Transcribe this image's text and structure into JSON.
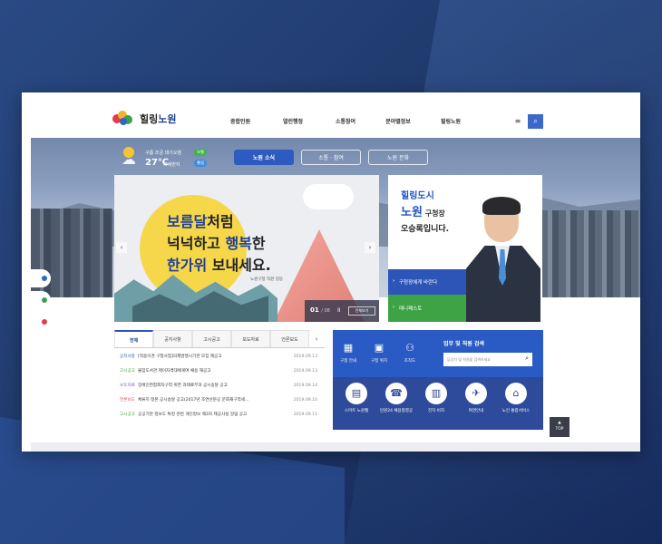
{
  "logo": {
    "name_prefix": "힐링",
    "name_main": "노원"
  },
  "gnb": [
    "종합민원",
    "열린행정",
    "소통참여",
    "분야별정보",
    "힐링노원"
  ],
  "header": {
    "menu_icon": "≡",
    "search_icon": "⌕"
  },
  "weather": {
    "line1": "구름 조금 대기오염",
    "temp": "27℃",
    "line2": "미세먼지",
    "badge_good1": "보통",
    "badge_good2": "좋음"
  },
  "visual_tabs": [
    {
      "label": "노원 소식",
      "active": true
    },
    {
      "label": "소통 · 참여",
      "active": false
    },
    {
      "label": "노원 문화",
      "active": false
    }
  ],
  "slide": {
    "line1_a": "보름달",
    "line1_b": "처럼",
    "line2_a": "넉넉하고 ",
    "line2_b": "행복",
    "line2_c": "한",
    "line3_a": "한가위",
    "line3_b": " 보내세요.",
    "sub": "노원구청 직원 일동",
    "counter_current": "01",
    "counter_total": "/ 08",
    "pause": "II",
    "view_all": "전체보기",
    "prev": "‹",
    "next": "›"
  },
  "mayor": {
    "line1": "힐링도시",
    "line2_name": "노원",
    "line2_title": " 구청장",
    "line3": "오승록입니다.",
    "btn1": "구청장에게 바란다",
    "btn2": "매니페스토",
    "chevron": "›"
  },
  "notice": {
    "tabs": [
      {
        "label": "전체",
        "active": true
      },
      {
        "label": "공지사항",
        "active": false
      },
      {
        "label": "고시공고",
        "active": false
      },
      {
        "label": "보도자료",
        "active": false
      },
      {
        "label": "언론보도",
        "active": false
      }
    ],
    "more": "›",
    "rows": [
      {
        "cat": "공지사항",
        "cat_color": "#2d55b8",
        "title": "[적용이견 구청사업]의제발행시기관 모집 제공고",
        "date": "2019.09.13"
      },
      {
        "cat": "고시공고",
        "cat_color": "#3ea345",
        "title": "불암도서관 제이자격대에게여 채용 재공고",
        "date": "2019.09.13"
      },
      {
        "cat": "보도자료",
        "cat_color": "#9c4cc2",
        "title": "장애인연합회자구역 위한 과태료부과 공시송달 공고",
        "date": "2019.09.14"
      },
      {
        "cat": "언론보도",
        "cat_color": "#e0484a",
        "title": "체류지 정본 공시송달 공고(2017년 조연산분공 문화재구역세...",
        "date": "2019.09.10"
      },
      {
        "cat": "고시공고",
        "cat_color": "#3ea345",
        "title": "공공기관 정보도 특정 관련 개인정보 제3자 제공사실 알림 공고",
        "date": "2019.09.11"
      }
    ]
  },
  "service": {
    "title": "업무 및 직원 검색",
    "placeholder": "담당자 및 직원을 검색하세요",
    "search_icon": "⌕",
    "top_items": [
      {
        "label": "구정 안내",
        "glyph": "▦"
      },
      {
        "label": "구청 위치",
        "glyph": "▣"
      },
      {
        "label": "조직도",
        "glyph": "⚇"
      }
    ],
    "circles": [
      {
        "label": "스마트 노원웹",
        "glyph": "▤"
      },
      {
        "label": "민원24 채용청결공",
        "glyph": "☎"
      },
      {
        "label": "전자 비자",
        "glyph": "▥"
      },
      {
        "label": "여권안내",
        "glyph": "✈"
      },
      {
        "label": "노인 통합서비스",
        "glyph": "⌂"
      }
    ]
  },
  "top_button": {
    "arrow": "▲",
    "label": "TOP"
  },
  "colors": {
    "primary": "#2d55b8",
    "green": "#3ea345",
    "background": "#1e3566"
  }
}
